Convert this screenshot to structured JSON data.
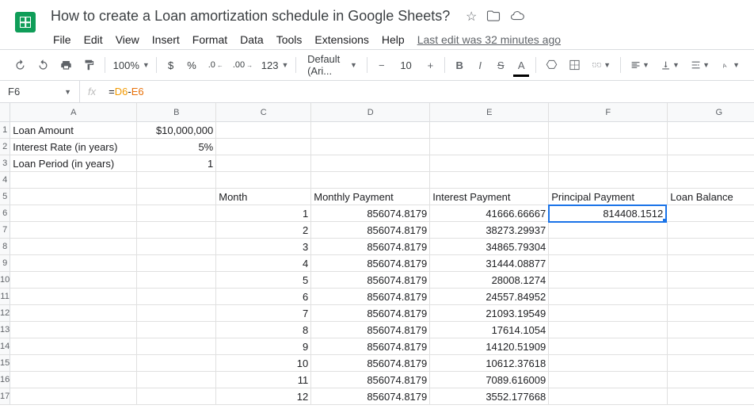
{
  "header": {
    "doc_title": "How to create a Loan amortization schedule in Google Sheets?",
    "menus": [
      "File",
      "Edit",
      "View",
      "Insert",
      "Format",
      "Data",
      "Tools",
      "Extensions",
      "Help"
    ],
    "last_edit": "Last edit was 32 minutes ago"
  },
  "toolbar": {
    "zoom": "100%",
    "currency": "$",
    "percent": "%",
    "dec_dec": ".0",
    "dec_inc": ".00",
    "more_fmt": "123",
    "font_family": "Default (Ari...",
    "font_size": "10",
    "bold": "B",
    "italic": "I",
    "strike": "S",
    "text_color": "A"
  },
  "formula_bar": {
    "name_box": "F6",
    "fx": "fx",
    "formula_eq": "=",
    "formula_ref1": "D6",
    "formula_op": "-",
    "formula_ref2": "E6"
  },
  "columns": [
    "A",
    "B",
    "C",
    "D",
    "E",
    "F",
    "G"
  ],
  "row_count": 17,
  "selected_cell": "F6",
  "cells": {
    "A1": "Loan Amount",
    "B1": "$10,000,000",
    "A2": "Interest Rate (in years)",
    "B2": "5%",
    "A3": "Loan Period (in years)",
    "B3": "1",
    "C5": "Month",
    "D5": "Monthly Payment",
    "E5": "Interest Payment",
    "F5": "Principal Payment",
    "G5": "Loan Balance",
    "C6": "1",
    "D6": "856074.8179",
    "E6": "41666.66667",
    "F6": "814408.1512",
    "C7": "2",
    "D7": "856074.8179",
    "E7": "38273.29937",
    "C8": "3",
    "D8": "856074.8179",
    "E8": "34865.79304",
    "C9": "4",
    "D9": "856074.8179",
    "E9": "31444.08877",
    "C10": "5",
    "D10": "856074.8179",
    "E10": "28008.1274",
    "C11": "6",
    "D11": "856074.8179",
    "E11": "24557.84952",
    "C12": "7",
    "D12": "856074.8179",
    "E12": "21093.19549",
    "C13": "8",
    "D13": "856074.8179",
    "E13": "17614.1054",
    "C14": "9",
    "D14": "856074.8179",
    "E14": "14120.51909",
    "C15": "10",
    "D15": "856074.8179",
    "E15": "10612.37618",
    "C16": "11",
    "D16": "856074.8179",
    "E16": "7089.616009",
    "C17": "12",
    "D17": "856074.8179",
    "E17": "3552.177668"
  },
  "chart_data": {
    "type": "table",
    "title": "Loan amortization schedule",
    "inputs": {
      "loan_amount": 10000000,
      "interest_rate_annual": 0.05,
      "loan_period_years": 1
    },
    "columns": [
      "Month",
      "Monthly Payment",
      "Interest Payment",
      "Principal Payment",
      "Loan Balance"
    ],
    "rows": [
      [
        1,
        856074.8179,
        41666.66667,
        814408.1512,
        null
      ],
      [
        2,
        856074.8179,
        38273.29937,
        null,
        null
      ],
      [
        3,
        856074.8179,
        34865.79304,
        null,
        null
      ],
      [
        4,
        856074.8179,
        31444.08877,
        null,
        null
      ],
      [
        5,
        856074.8179,
        28008.1274,
        null,
        null
      ],
      [
        6,
        856074.8179,
        24557.84952,
        null,
        null
      ],
      [
        7,
        856074.8179,
        21093.19549,
        null,
        null
      ],
      [
        8,
        856074.8179,
        17614.1054,
        null,
        null
      ],
      [
        9,
        856074.8179,
        14120.51909,
        null,
        null
      ],
      [
        10,
        856074.8179,
        10612.37618,
        null,
        null
      ],
      [
        11,
        856074.8179,
        7089.616009,
        null,
        null
      ],
      [
        12,
        856074.8179,
        3552.177668,
        null,
        null
      ]
    ]
  }
}
